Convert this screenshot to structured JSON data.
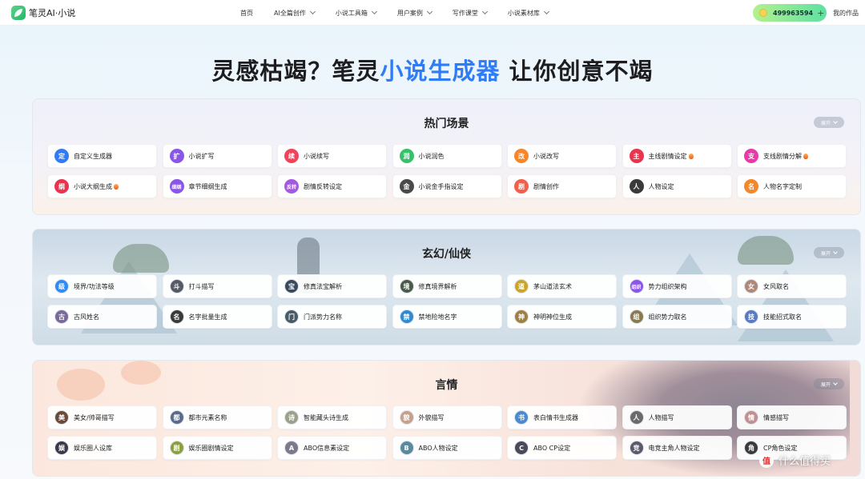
{
  "brand": {
    "name": "笔灵AI·小说"
  },
  "nav": {
    "items": [
      {
        "label": "首页",
        "dropdown": false
      },
      {
        "label": "AI全篇创作",
        "dropdown": true
      },
      {
        "label": "小说工具箱",
        "dropdown": true
      },
      {
        "label": "用户案例",
        "dropdown": true
      },
      {
        "label": "写作课堂",
        "dropdown": true
      },
      {
        "label": "小说素材库",
        "dropdown": true
      }
    ],
    "credits": "499963594",
    "credits_plus": "+",
    "my_works": "我的作品"
  },
  "hero": {
    "part1": "灵感枯竭？笔灵",
    "highlight": "小说生成器",
    "part2": " 让你创意不竭"
  },
  "sections": [
    {
      "title": "热门场景",
      "expand": "展开",
      "items": [
        {
          "label": "自定义生成器",
          "icon": "定",
          "color": "#2f7cf6",
          "hot": false
        },
        {
          "label": "小说扩写",
          "icon": "扩",
          "color": "#8a56e8",
          "hot": false
        },
        {
          "label": "小说续写",
          "icon": "续",
          "color": "#f0435a",
          "hot": false
        },
        {
          "label": "小说润色",
          "icon": "润",
          "color": "#36c16b",
          "hot": false
        },
        {
          "label": "小说改写",
          "icon": "改",
          "color": "#f5862a",
          "hot": false
        },
        {
          "label": "主线剧情设定",
          "icon": "主",
          "color": "#e8344e",
          "hot": true
        },
        {
          "label": "支线剧情分解",
          "icon": "支",
          "color": "#e83aa8",
          "hot": true
        },
        {
          "label": "小说大纲生成",
          "icon": "纲",
          "color": "#e8344e",
          "hot": true
        },
        {
          "label": "章节细纲生成",
          "icon": "细纲",
          "color": "#8a56e8",
          "hot": false
        },
        {
          "label": "剧情反转设定",
          "icon": "反转",
          "color": "#a45ae0",
          "hot": false
        },
        {
          "label": "小说金手指设定",
          "icon": "金",
          "color": "#4a4a4a",
          "hot": false
        },
        {
          "label": "剧情创作",
          "icon": "剧",
          "color": "#f0604a",
          "hot": false
        },
        {
          "label": "人物设定",
          "icon": "人",
          "color": "#3a3a3a",
          "hot": false
        },
        {
          "label": "人物名字定制",
          "icon": "名",
          "color": "#f5862a",
          "hot": false
        }
      ]
    },
    {
      "title": "玄幻/仙侠",
      "expand": "展开",
      "items": [
        {
          "label": "境界/功法等级",
          "icon": "级",
          "color": "#2f8cf6",
          "hot": false
        },
        {
          "label": "打斗描写",
          "icon": "斗",
          "color": "#555a66",
          "hot": false
        },
        {
          "label": "修真法宝解析",
          "icon": "宝",
          "color": "#3b4a5a",
          "hot": false
        },
        {
          "label": "修真境界解析",
          "icon": "境",
          "color": "#4a5a4a",
          "hot": false
        },
        {
          "label": "茅山道法玄术",
          "icon": "道",
          "color": "#c9a628",
          "hot": false
        },
        {
          "label": "势力组织架构",
          "icon": "组织",
          "color": "#8a56e8",
          "hot": false
        },
        {
          "label": "女风取名",
          "icon": "女",
          "color": "#b08878",
          "hot": false
        },
        {
          "label": "古风姓名",
          "icon": "古",
          "color": "#7a6a9a",
          "hot": false
        },
        {
          "label": "名字批量生成",
          "icon": "名",
          "color": "#3a3a3a",
          "hot": false
        },
        {
          "label": "门派势力名称",
          "icon": "门",
          "color": "#4a5a66",
          "hot": false
        },
        {
          "label": "禁地险地名字",
          "icon": "禁",
          "color": "#2f8ad0",
          "hot": false
        },
        {
          "label": "神明神位生成",
          "icon": "神",
          "color": "#a08040",
          "hot": false
        },
        {
          "label": "组织势力取名",
          "icon": "组",
          "color": "#8a7a50",
          "hot": false
        },
        {
          "label": "技能招式取名",
          "icon": "技",
          "color": "#5a7ac0",
          "hot": false
        }
      ]
    },
    {
      "title": "言情",
      "expand": "展开",
      "items": [
        {
          "label": "美女/帅哥描写",
          "icon": "美",
          "color": "#6a4a3a",
          "hot": false
        },
        {
          "label": "都市元素名称",
          "icon": "都",
          "color": "#5a6a8a",
          "hot": false
        },
        {
          "label": "智能藏头诗生成",
          "icon": "诗",
          "color": "#9aa08a",
          "hot": false
        },
        {
          "label": "外貌描写",
          "icon": "貌",
          "color": "#c8a08a",
          "hot": false
        },
        {
          "label": "表白情书生成器",
          "icon": "书",
          "color": "#4a8ad0",
          "hot": false
        },
        {
          "label": "人物描写",
          "icon": "人",
          "color": "#6a6a6a",
          "hot": false
        },
        {
          "label": "情感描写",
          "icon": "情",
          "color": "#c09090",
          "hot": false
        },
        {
          "label": "娱乐圈人设库",
          "icon": "娱",
          "color": "#3a3a4a",
          "hot": false
        },
        {
          "label": "娱乐圈剧情设定",
          "icon": "剧",
          "color": "#8aa040",
          "hot": false
        },
        {
          "label": "ABO信息素设定",
          "icon": "A",
          "color": "#7a7a8a",
          "hot": false
        },
        {
          "label": "ABO人物设定",
          "icon": "B",
          "color": "#5a8aa0",
          "hot": false
        },
        {
          "label": "ABO CP设定",
          "icon": "C",
          "color": "#4a4a5a",
          "hot": false
        },
        {
          "label": "电竞主角人物设定",
          "icon": "竞",
          "color": "#5a5a6a",
          "hot": false
        },
        {
          "label": "CP角色设定",
          "icon": "角",
          "color": "#3a3a3a",
          "hot": false
        }
      ]
    }
  ],
  "watermark": {
    "badge": "值",
    "text": "什么值得买"
  }
}
